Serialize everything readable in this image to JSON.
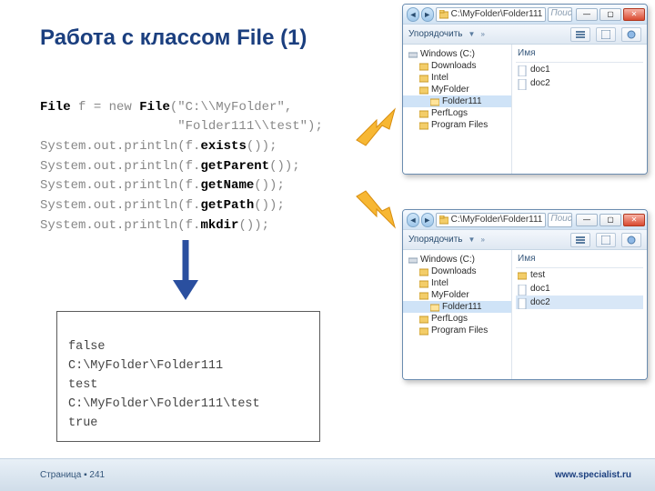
{
  "slide": {
    "title": "Работа с классом File (1)",
    "page_label": "Страница ▪ 241",
    "site": "www.specialist.ru"
  },
  "code": {
    "l1a": "File",
    "l1b": " f = new ",
    "l1c": "File",
    "l1d": "(\"C:\\\\MyFolder\",",
    "l2": "                  \"Folder111\\\\test\");",
    "l3a": "System.out.println(f.",
    "l3b": "exists",
    "l3c": "());",
    "l4a": "System.out.println(f.",
    "l4b": "getParent",
    "l4c": "());",
    "l5a": "System.out.println(f.",
    "l5b": "getName",
    "l5c": "());",
    "l6a": "System.out.println(f.",
    "l6b": "getPath",
    "l6c": "());",
    "l7a": "System.out.println(f.",
    "l7b": "mkdir",
    "l7c": "());"
  },
  "output": {
    "l1": "false",
    "l2": "C:\\MyFolder\\Folder111",
    "l3": "test",
    "l4": "C:\\MyFolder\\Folder111\\test",
    "l5": "true"
  },
  "explorer": {
    "address_prefix_icon": "pc",
    "address": "C:\\MyFolder\\Folder111",
    "search_placeholder": "Поиск: Fo",
    "toolbar": {
      "organize": "Упорядочить",
      "chev": "»"
    },
    "tree": {
      "root": "Windows (C:)",
      "items": [
        "Downloads",
        "Intel",
        "MyFolder",
        "Folder111",
        "PerfLogs",
        "Program Files"
      ]
    },
    "files_header": "Имя",
    "files_before": [
      "doc1",
      "doc2"
    ],
    "files_after": [
      "test",
      "doc1",
      "doc2"
    ]
  }
}
